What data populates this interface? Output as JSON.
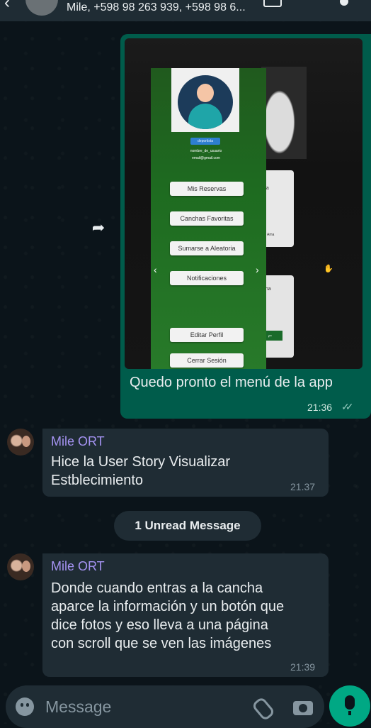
{
  "header": {
    "title": "Mile, +598 98 263 939, +598 98 6..."
  },
  "outgoing_message": {
    "caption": "Quedo pronto el menú de la app",
    "time": "21:36",
    "photo": {
      "profile_tag": "deportista",
      "username": "nombre_de_usuario",
      "email": "email@gmail.com",
      "menu_buttons": [
        "Mis Reservas",
        "Canchas Favoritas",
        "Sumarse a Aleatoria",
        "Notificaciones",
        "Editar Perfil",
        "Cerrar Sesión"
      ],
      "card_labels": [
        "pa",
        "Ama",
        "nha"
      ]
    }
  },
  "incoming_messages": [
    {
      "sender": "Mile ORT",
      "lines": [
        "Hice la User Story Visualizar",
        "Estblecimiento"
      ],
      "time": "21.37"
    },
    {
      "sender": "Mile ORT",
      "lines": [
        "Donde cuando entras a la cancha",
        "aparce la información y un botón que",
        "dice fotos y eso lleva a una página",
        "con scroll que se ven las imágenes"
      ],
      "time": "21:39"
    }
  ],
  "unread_banner": "1 Unread Message",
  "composer": {
    "placeholder": "Message"
  },
  "colors": {
    "background": "#0b141a",
    "outgoing_bubble": "#005c4b",
    "incoming_bubble": "#1f2c34",
    "sender_name": "#a593f2",
    "accent": "#00a884"
  }
}
